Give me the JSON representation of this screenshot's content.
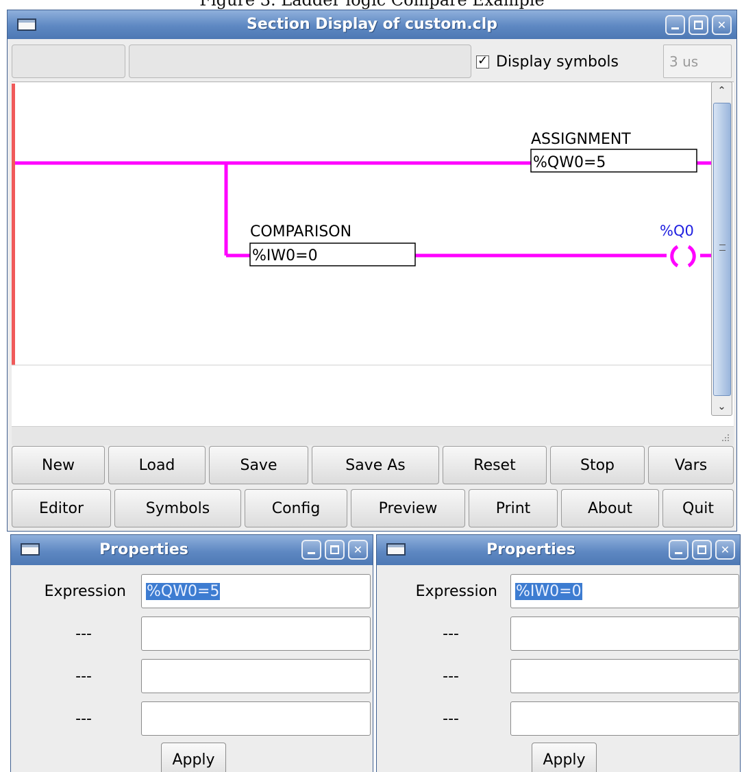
{
  "caption": "Figure 3. Ladder logic Compare Example",
  "main_window": {
    "title": "Section Display of custom.clp",
    "display_symbols_label": "Display symbols",
    "display_symbols_checked": true,
    "cycle_time": "3 us",
    "ladder": {
      "assignment_title": "ASSIGNMENT",
      "assignment_expr": "%QW0=5",
      "comparison_title": "COMPARISON",
      "comparison_expr": "%IW0=0",
      "coil_label": "%Q0",
      "rail_color": "#f05a5a",
      "wire_color": "#ff00ff",
      "coil_label_color": "#2020e0"
    },
    "toolbar_row1": [
      "New",
      "Load",
      "Save",
      "Save As",
      "Reset",
      "Stop",
      "Vars"
    ],
    "toolbar_row2": [
      "Editor",
      "Symbols",
      "Config",
      "Preview",
      "Print",
      "About",
      "Quit"
    ]
  },
  "properties_left": {
    "title": "Properties",
    "rows": [
      {
        "label": "Expression",
        "value": "%QW0=5"
      },
      {
        "label": "---",
        "value": ""
      },
      {
        "label": "---",
        "value": ""
      },
      {
        "label": "---",
        "value": ""
      }
    ],
    "apply_label": "Apply"
  },
  "properties_right": {
    "title": "Properties",
    "rows": [
      {
        "label": "Expression",
        "value": "%IW0=0"
      },
      {
        "label": "---",
        "value": ""
      },
      {
        "label": "---",
        "value": ""
      },
      {
        "label": "---",
        "value": ""
      }
    ],
    "apply_label": "Apply"
  },
  "icons": {
    "window_menu": "window-menu-icon",
    "minimize": "minimize-icon",
    "maximize": "maximize-icon",
    "close": "close-icon",
    "scroll_up": "scroll-up-arrow-icon",
    "scroll_down": "scroll-down-arrow-icon",
    "resize_grip": "resize-grip-icon"
  }
}
